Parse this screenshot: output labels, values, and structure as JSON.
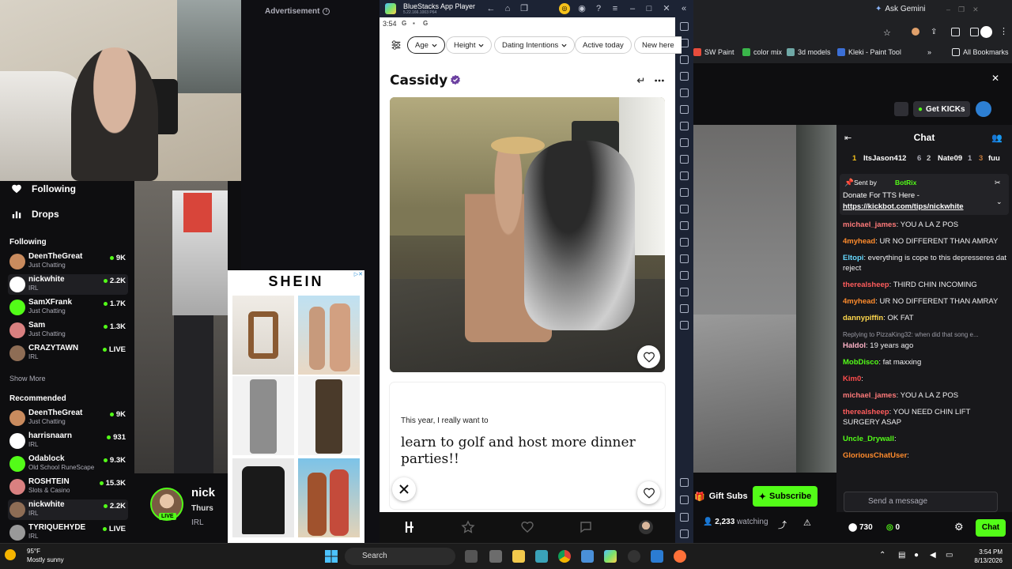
{
  "ad": {
    "label": "Advertisement",
    "brand": "SHEIN"
  },
  "kick_sidebar": {
    "nav": [
      "Following",
      "Drops"
    ],
    "following_title": "Following",
    "following": [
      {
        "name": "DeenTheGreat",
        "category": "Just Chatting",
        "viewers": "9K"
      },
      {
        "name": "nickwhite",
        "category": "IRL",
        "viewers": "2.2K"
      },
      {
        "name": "SamXFrank",
        "category": "Just Chatting",
        "viewers": "1.7K"
      },
      {
        "name": "Sam",
        "category": "Just Chatting",
        "viewers": "1.3K"
      },
      {
        "name": "CRAZYTAWN",
        "category": "IRL",
        "viewers": "LIVE"
      }
    ],
    "show_more": "Show More",
    "recommended_title": "Recommended",
    "recommended": [
      {
        "name": "DeenTheGreat",
        "category": "Just Chatting",
        "viewers": "9K"
      },
      {
        "name": "harrisnaarn",
        "category": "IRL",
        "viewers": "931"
      },
      {
        "name": "Odablock",
        "category": "Old School RuneScape",
        "viewers": "9.3K"
      },
      {
        "name": "ROSHTEIN",
        "category": "Slots & Casino",
        "viewers": "15.3K"
      },
      {
        "name": "nickwhite",
        "category": "IRL",
        "viewers": "2.2K"
      },
      {
        "name": "TYRIQUEHYDE",
        "category": "IRL",
        "viewers": "LIVE"
      }
    ]
  },
  "streamer": {
    "name": "nick",
    "date": "Thurs",
    "category": "IRL",
    "live": "LIVE"
  },
  "bluestacks": {
    "title": "BlueStacks App Player",
    "subtitle": "5.22.166.1003 P64",
    "time": "3:54"
  },
  "hinge": {
    "filters": [
      "Age",
      "Height",
      "Dating Intentions",
      "Active today",
      "New here"
    ],
    "profile_name": "Cassidy",
    "prompt_question": "This year, I really want to",
    "prompt_answer": "learn to golf and host more dinner parties!!"
  },
  "browser": {
    "ask_gemini": "Ask Gemini",
    "bookmarks": [
      "SW Paint",
      "color mix",
      "3d models",
      "Kleki - Paint Tool"
    ],
    "all_bookmarks": "All Bookmarks"
  },
  "kick_chat": {
    "get_kicks": "Get KICKs",
    "title": "Chat",
    "gifters": [
      {
        "rank": "1",
        "name": "ItsJason412",
        "count": "6"
      },
      {
        "rank": "2",
        "name": "Nate09",
        "count": "1"
      },
      {
        "rank": "3",
        "name": "fuu",
        "count": ""
      }
    ],
    "pinned_sent_by": "Sent by",
    "pinned_bot": "BotRix",
    "pinned_text": "Donate For TTS Here -",
    "pinned_link": "https://kickbot.com/tips/nickwhite",
    "messages": [
      {
        "user": "michael_james",
        "text": ": YOU A LA Z POS",
        "color": "#ff7a7a",
        "reply": ""
      },
      {
        "user": "4myhead",
        "text": ": UR NO DIFFERENT THAN AMRAY",
        "color": "#ff8b2c",
        "reply": ""
      },
      {
        "user": "Eltopi",
        "text": ": everything is cope to this depresseres dat reject",
        "color": "#66d9ff",
        "reply": ""
      },
      {
        "user": "therealsheep",
        "text": ": THIRD CHIN INCOMING",
        "color": "#ff5c5c",
        "reply": ""
      },
      {
        "user": "4myhead",
        "text": ": UR NO DIFFERENT THAN AMRAY",
        "color": "#ff8b2c",
        "reply": ""
      },
      {
        "user": "dannypiffin",
        "text": ": OK FAT",
        "color": "#ffd84d",
        "reply": ""
      },
      {
        "user": "Haldol",
        "text": ": 19 years ago",
        "color": "#ffb3c7",
        "reply": "Replying to PizzaKing32: when did that song e..."
      },
      {
        "user": "MobDisco",
        "text": ": fat maxxing",
        "color": "#53fc18",
        "reply": ""
      },
      {
        "user": "Kim0",
        "text": ":",
        "color": "#ff4d4d",
        "reply": ""
      },
      {
        "user": "michael_james",
        "text": ": YOU A LA Z POS",
        "color": "#ff7a7a",
        "reply": ""
      },
      {
        "user": "therealsheep",
        "text": ": YOU NEED CHIN LIFT SURGERY ASAP",
        "color": "#ff5c5c",
        "reply": ""
      },
      {
        "user": "Uncle_Drywall",
        "text": ":",
        "color": "#53fc18",
        "reply": ""
      },
      {
        "user": "GloriousChatUser",
        "text": ":",
        "color": "#ff8b2c",
        "reply": ""
      }
    ],
    "gift_subs": "Gift Subs",
    "subscribe": "Subscribe",
    "send_placeholder": "Send a message",
    "watching_count": "2,233",
    "watching_label": "watching",
    "kicks": "730",
    "points": "0",
    "chat_button": "Chat"
  },
  "taskbar": {
    "temp": "95°F",
    "weather": "Mostly sunny",
    "search": "Search",
    "time": "3:54 PM",
    "date": "8/13/2026"
  }
}
